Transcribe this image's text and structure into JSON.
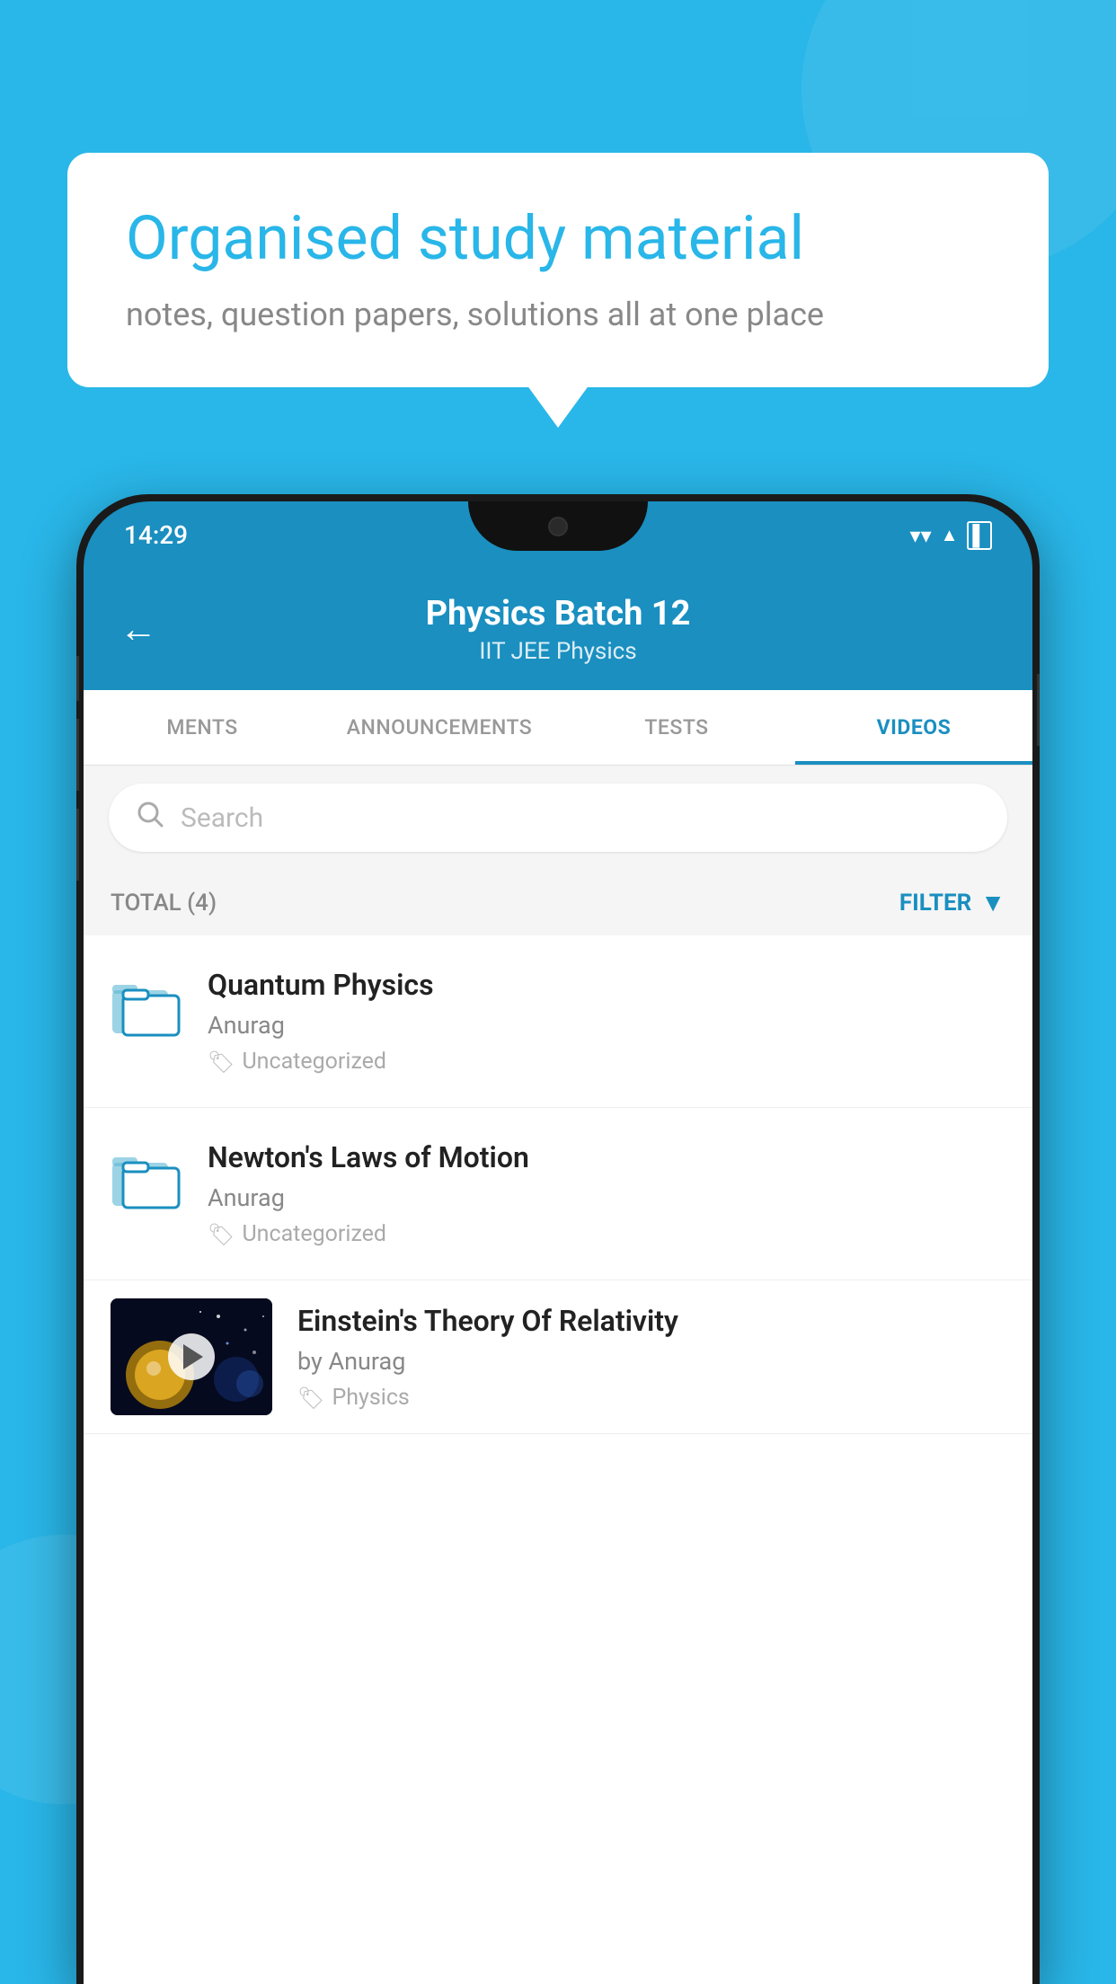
{
  "background": {
    "color": "#29b6e8"
  },
  "speech_bubble": {
    "title": "Organised study material",
    "subtitle": "notes, question papers, solutions all at one place"
  },
  "phone": {
    "status_bar": {
      "time": "14:29",
      "icons": [
        "wifi",
        "signal",
        "battery"
      ]
    },
    "header": {
      "back_label": "←",
      "title": "Physics Batch 12",
      "subtitle": "IIT JEE   Physics"
    },
    "tabs": [
      {
        "label": "MENTS",
        "active": false
      },
      {
        "label": "ANNOUNCEMENTS",
        "active": false
      },
      {
        "label": "TESTS",
        "active": false
      },
      {
        "label": "VIDEOS",
        "active": true
      }
    ],
    "search": {
      "placeholder": "Search"
    },
    "filter_bar": {
      "total_label": "TOTAL (4)",
      "filter_label": "FILTER"
    },
    "list_items": [
      {
        "title": "Quantum Physics",
        "author": "Anurag",
        "tag": "Uncategorized",
        "type": "folder"
      },
      {
        "title": "Newton's Laws of Motion",
        "author": "Anurag",
        "tag": "Uncategorized",
        "type": "folder"
      },
      {
        "title": "Einstein's Theory Of Relativity",
        "author": "by Anurag",
        "tag": "Physics",
        "type": "video"
      }
    ]
  }
}
